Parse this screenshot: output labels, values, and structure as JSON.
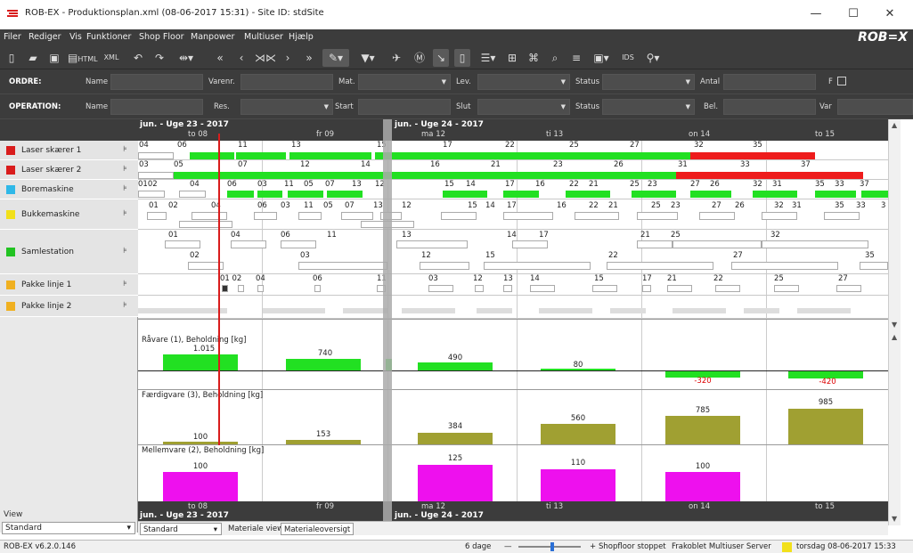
{
  "window": {
    "title": "ROB-EX - Produktionsplan.xml (08-06-2017 15:31) - Site ID: stdSite",
    "minimize": "—",
    "maximize": "☐",
    "close": "✕"
  },
  "menu": {
    "items": [
      "Filer",
      "Rediger",
      "Vis",
      "Funktioner",
      "Shop Floor",
      "Manpower",
      "Multiuser",
      "Hjælp"
    ],
    "logo": "ROB=X"
  },
  "toolbar": {
    "icons": [
      "new-file-icon",
      "open-folder-icon",
      "save-icon",
      "save-html-icon",
      "xml-in-icon",
      "undo-icon",
      "redo-icon",
      "fit-width-icon",
      "scroll-first-icon",
      "scroll-prev-icon",
      "zoom-center-icon",
      "scroll-next-icon",
      "scroll-last-icon",
      "pencil-icon",
      "filter-icon",
      "move-icon",
      "material-icon",
      "link-icon",
      "document-icon",
      "list-icon",
      "grid-icon",
      "connect-icon",
      "search-icon",
      "list-view-icon",
      "window-icon",
      "ids-icon",
      "hierarchy-icon"
    ],
    "xml_label": "XML",
    "html_label": "HTML",
    "ids_label": "IDS"
  },
  "filters": {
    "ordre": {
      "label": "ORDRE:",
      "fields": [
        {
          "label": "Name",
          "value": ""
        },
        {
          "label": "Varenr.",
          "value": ""
        },
        {
          "label": "Mat.",
          "value": ""
        },
        {
          "label": "Lev.",
          "value": ""
        },
        {
          "label": "Status",
          "value": ""
        },
        {
          "label": "Antal",
          "value": ""
        },
        {
          "label": "F",
          "value": ""
        }
      ]
    },
    "operation": {
      "label": "OPERATION:",
      "fields": [
        {
          "label": "Name",
          "value": ""
        },
        {
          "label": "Res.",
          "value": ""
        },
        {
          "label": "Start",
          "value": ""
        },
        {
          "label": "Slut",
          "value": ""
        },
        {
          "label": "Status",
          "value": ""
        },
        {
          "label": "Bel.",
          "value": ""
        },
        {
          "label": "Var",
          "value": ""
        }
      ]
    }
  },
  "timeline": {
    "weeks": [
      "jun. - Uge 23 - 2017",
      "jun. - Uge 24 - 2017"
    ],
    "days": [
      "to 08",
      "fr 09",
      "ma 12",
      "ti 13",
      "on 14",
      "to 15"
    ]
  },
  "resources": [
    {
      "name": "Laser skærer 1",
      "color": "#d91c1c"
    },
    {
      "name": "Laser skærer 2",
      "color": "#d91c1c"
    },
    {
      "name": "Boremaskine",
      "color": "#2fb8e8"
    },
    {
      "name": "Bukkemaskine",
      "color": "#f2e01a"
    },
    {
      "name": "Samlestation",
      "color": "#22c322"
    },
    {
      "name": "Pakke linje 1",
      "color": "#f0b020"
    },
    {
      "name": "Pakke linje 2",
      "color": "#f0b020"
    }
  ],
  "gantt_labels": {
    "laser1": [
      "04",
      "06",
      "11",
      "13",
      "15",
      "17",
      "22",
      "25",
      "27",
      "32",
      "35"
    ],
    "laser2": [
      "03",
      "05",
      "07",
      "12",
      "14",
      "16",
      "21",
      "23",
      "26",
      "31",
      "33",
      "37"
    ],
    "bore": [
      "0102",
      "04",
      "06",
      "03",
      "11",
      "05",
      "07",
      "13",
      "12",
      "15",
      "14",
      "17",
      "16",
      "22",
      "21",
      "25",
      "23",
      "27",
      "26",
      "32",
      "31",
      "35",
      "33",
      "37"
    ],
    "bukke": [
      "01",
      "02",
      "04",
      "06",
      "03",
      "11",
      "05",
      "07",
      "13",
      "12",
      "15",
      "14",
      "17",
      "16",
      "22",
      "21",
      "25",
      "23",
      "27",
      "26",
      "32",
      "31",
      "35",
      "33",
      "3"
    ],
    "samle_top": [
      "01",
      "04",
      "06",
      "11",
      "13",
      "14",
      "17",
      "21",
      "25",
      "32"
    ],
    "samle_bot": [
      "02",
      "03",
      "12",
      "15",
      "22",
      "27",
      "35"
    ],
    "pakke1": [
      "01 02",
      "04",
      "06",
      "11",
      "03",
      "12",
      "13",
      "14",
      "15",
      "17",
      "21",
      "22",
      "25",
      "27"
    ]
  },
  "charts": [
    {
      "title": "Råvare (1), Beholdning [kg]",
      "color": "#22e022",
      "values": [
        "1.015",
        "740",
        "490",
        "80",
        "-320",
        "-420"
      ]
    },
    {
      "title": "Færdigvare (3), Beholdning [kg]",
      "color": "#a0a032",
      "values": [
        "100",
        "153",
        "384",
        "560",
        "785",
        "985"
      ]
    },
    {
      "title": "Mellemvare (2), Beholdning [kg]",
      "color": "#ee10ee",
      "values": [
        "100",
        "",
        "125",
        "110",
        "100",
        ""
      ]
    }
  ],
  "sidebar": {
    "view_label": "View",
    "view_value": "Standard"
  },
  "tabs": {
    "standard_value": "Standard",
    "items": [
      "Materiale view",
      "Materialeoversigt"
    ]
  },
  "statusbar": {
    "version": "ROB-EX v6.2.0.146",
    "days": "6 dage",
    "minus": "—",
    "plus": "+",
    "shopfloor": "Shopfloor stoppet",
    "multiuser": "Frakoblet Multiuser Server",
    "datetime": "torsdag 08-06-2017 15:33",
    "indicator_color": "#f2e01a"
  }
}
